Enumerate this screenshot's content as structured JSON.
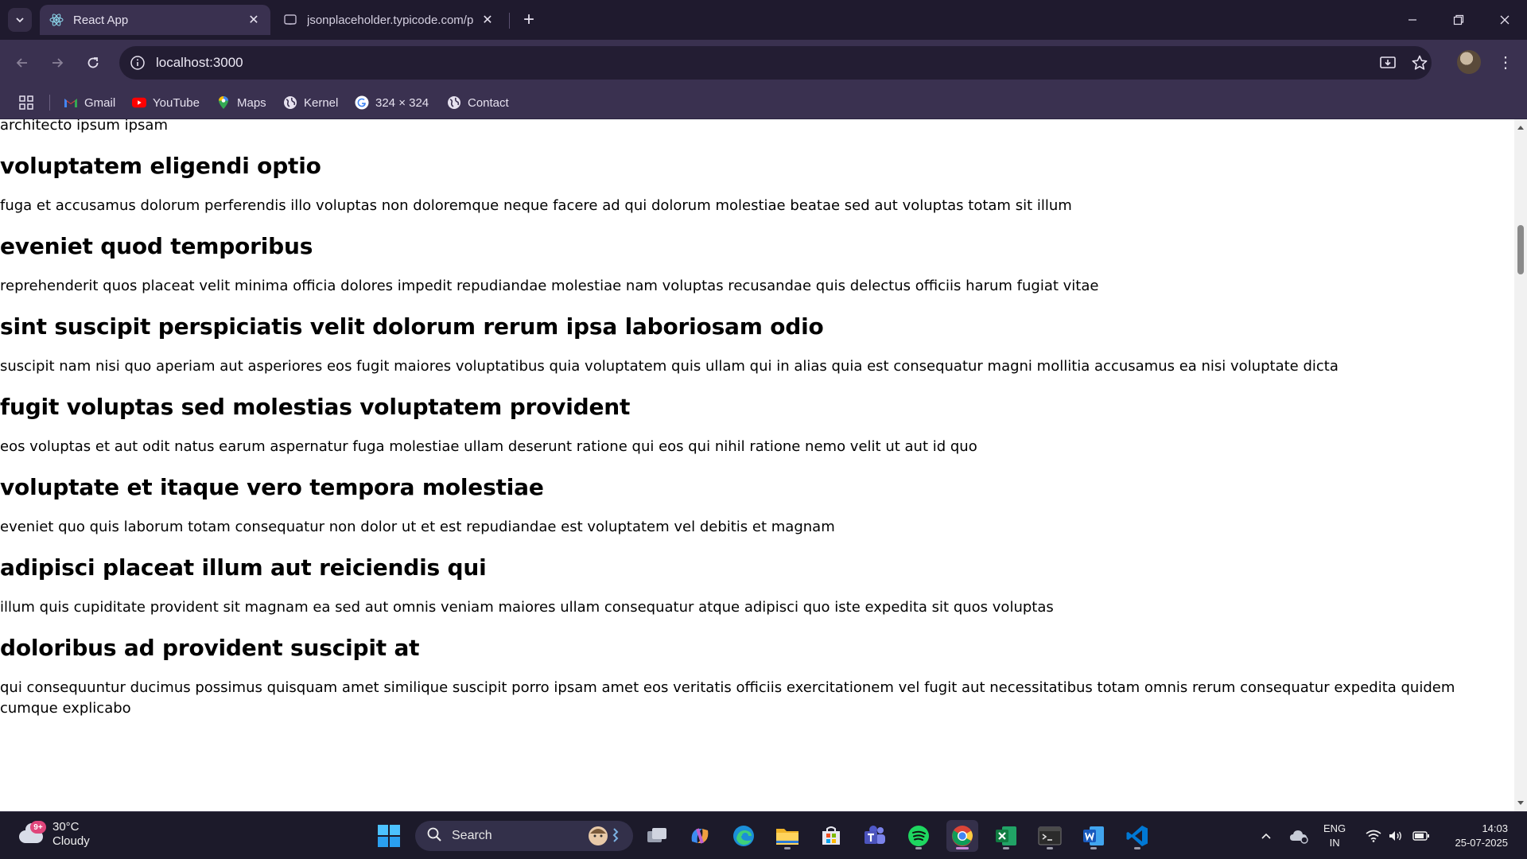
{
  "browser": {
    "tabs": [
      {
        "title": "React App",
        "active": true
      },
      {
        "title": "jsonplaceholder.typicode.com/p",
        "active": false
      }
    ],
    "address": "localhost:3000",
    "bookmarks": [
      {
        "label": "Gmail",
        "icon": "gmail-icon"
      },
      {
        "label": "YouTube",
        "icon": "youtube-icon"
      },
      {
        "label": "Maps",
        "icon": "maps-icon"
      },
      {
        "label": "Kernel",
        "icon": "globe-icon"
      },
      {
        "label": "324 × 324",
        "icon": "google-icon"
      },
      {
        "label": "Contact",
        "icon": "globe-icon"
      }
    ]
  },
  "page": {
    "partial_top": "architecto ipsum ipsam",
    "posts": [
      {
        "title": "voluptatem eligendi optio",
        "body": "fuga et accusamus dolorum perferendis illo voluptas non doloremque neque facere ad qui dolorum molestiae beatae sed aut voluptas totam sit illum"
      },
      {
        "title": "eveniet quod temporibus",
        "body": "reprehenderit quos placeat velit minima officia dolores impedit repudiandae molestiae nam voluptas recusandae quis delectus officiis harum fugiat vitae"
      },
      {
        "title": "sint suscipit perspiciatis velit dolorum rerum ipsa laboriosam odio",
        "body": "suscipit nam nisi quo aperiam aut asperiores eos fugit maiores voluptatibus quia voluptatem quis ullam qui in alias quia est consequatur magni mollitia accusamus ea nisi voluptate dicta"
      },
      {
        "title": "fugit voluptas sed molestias voluptatem provident",
        "body": "eos voluptas et aut odit natus earum aspernatur fuga molestiae ullam deserunt ratione qui eos qui nihil ratione nemo velit ut aut id quo"
      },
      {
        "title": "voluptate et itaque vero tempora molestiae",
        "body": "eveniet quo quis laborum totam consequatur non dolor ut et est repudiandae est voluptatem vel debitis et magnam"
      },
      {
        "title": "adipisci placeat illum aut reiciendis qui",
        "body": "illum quis cupiditate provident sit magnam ea sed aut omnis veniam maiores ullam consequatur atque adipisci quo iste expedita sit quos voluptas"
      },
      {
        "title": "doloribus ad provident suscipit at",
        "body": "qui consequuntur ducimus possimus quisquam amet similique suscipit porro ipsam amet eos veritatis officiis exercitationem vel fugit aut necessitatibus totam omnis rerum consequatur expedita quidem cumque explicabo"
      }
    ]
  },
  "taskbar": {
    "weather": {
      "temp": "30°C",
      "condition": "Cloudy",
      "badge": "9+"
    },
    "search_label": "Search",
    "lang_top": "ENG",
    "lang_bottom": "IN",
    "time": "14:03",
    "date": "25-07-2025",
    "apps": [
      "task-view-icon",
      "copilot-icon",
      "edge-icon",
      "file-explorer-icon",
      "store-icon",
      "teams-icon",
      "spotify-icon",
      "chrome-icon",
      "excel-icon",
      "terminal-icon",
      "word-icon",
      "vscode-icon"
    ]
  }
}
